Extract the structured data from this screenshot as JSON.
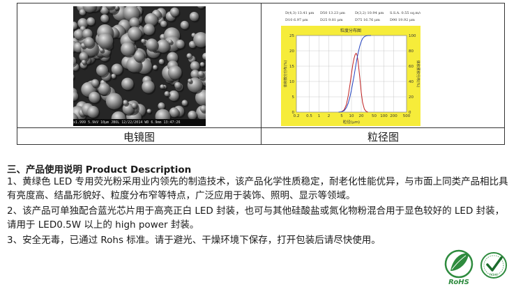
{
  "table": {
    "left_caption": "电镜图",
    "right_caption": "粒径图"
  },
  "sem_image": {
    "footer_text": "x1.999  5.9kV  10μm  JBOL  12/22/2014  WD  6.9mm  13:47:26"
  },
  "psd_chart": {
    "stats": [
      {
        "label": "D(4,3)",
        "value": "13.41 μm"
      },
      {
        "label": "D50",
        "value": "13.23 μm"
      },
      {
        "label": "D(3,2)",
        "value": "10.94 μm"
      },
      {
        "label": "S.S.A.",
        "value": "0.55 sq.m/c.c."
      },
      {
        "label": "D10",
        "value": "6.97 μm"
      },
      {
        "label": "D25",
        "value": "9.81 μm"
      },
      {
        "label": "D75",
        "value": "16.76 μm"
      },
      {
        "label": "D90",
        "value": "19.92 μm"
      }
    ],
    "title": "粒度分布图",
    "xlabel": "粒径(μm)",
    "ylabel_left": "体积微分分布(%)",
    "ylabel_right": "体积累积分布(%)"
  },
  "chart_data": {
    "type": "line",
    "title": "粒度分布图",
    "xlabel": "粒径(μm)",
    "ylabel": "体积微分分布(%)",
    "y2label": "体积累积分布(%)",
    "xscale": "log",
    "xticks": [
      "0.2",
      "0.5",
      "1",
      "2",
      "5",
      "10",
      "20",
      "50",
      "100",
      "200",
      "500"
    ],
    "yticks": [
      0,
      5,
      10,
      15,
      20,
      25
    ],
    "y2ticks": [
      0,
      20,
      40,
      60,
      80,
      100
    ],
    "xlim": [
      0.2,
      500
    ],
    "ylim": [
      0,
      25
    ],
    "y2lim": [
      0,
      100
    ],
    "grid": true,
    "series": [
      {
        "axis": "left",
        "color": "#c02020",
        "x": [
          5,
          6,
          7,
          8,
          9,
          10,
          11,
          12,
          13,
          14,
          15,
          16,
          18,
          20,
          22,
          25,
          28,
          32
        ],
        "values": [
          0.1,
          0.8,
          2.5,
          5.5,
          9.0,
          12.5,
          15.5,
          17.5,
          18.8,
          19.2,
          18.5,
          16.5,
          11.5,
          6.5,
          3.2,
          1.0,
          0.3,
          0
        ]
      },
      {
        "axis": "right",
        "color": "#2040c0",
        "x": [
          4,
          5,
          6,
          7,
          8,
          9,
          10,
          12,
          14,
          16,
          18,
          20,
          22,
          25,
          28,
          32,
          40
        ],
        "values": [
          0,
          0.5,
          2,
          6,
          12,
          20,
          29,
          47,
          64,
          77,
          86,
          92,
          96,
          98.5,
          99.5,
          100,
          100
        ]
      }
    ]
  },
  "section": {
    "heading": "三、产品使用说明 Product Description",
    "paragraphs": [
      "1、黄绿色 LED 专用荧光粉采用业内领先的制造技术，该产品化学性质稳定，耐老化性能优异，与市面上同类产品相比具有亮度高、结晶形貌好、粒度分布窄等特点，广泛应用于装饰、照明、显示等领域。",
      "2、该产品可单独配合蓝光芯片用于高亮正白 LED 封装，也可与其他硅酸盐或氮化物粉混合用于显色较好的 LED 封装，请用于 LED0.5W 以上的 high power 封装。",
      "3、安全无毒，已通过 Rohs 标准。请于避光、干燥环境下保存，打开包装后请尽快使用。"
    ]
  },
  "logos": {
    "rohs_text": "RoHS",
    "badge_text": "ROHS"
  },
  "colors": {
    "chart_bg": "#f6ec3a",
    "accent_green": "#2e8b3e"
  }
}
